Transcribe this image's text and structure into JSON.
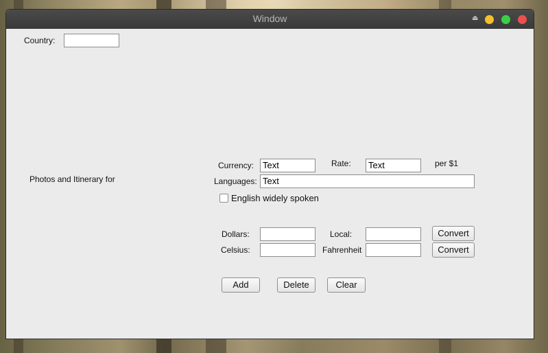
{
  "window": {
    "title": "Window"
  },
  "form": {
    "country_label": "Country:",
    "country_value": "",
    "photos_label": "Photos and Itinerary for",
    "currency_label": "Currency:",
    "currency_value": "Text",
    "rate_label": "Rate:",
    "rate_value": "Text",
    "per_dollar_label": "per $1",
    "languages_label": "Languages:",
    "languages_value": "Text",
    "english_checkbox_label": "English widely spoken",
    "english_checked": false,
    "dollars_label": "Dollars:",
    "dollars_value": "",
    "local_label": "Local:",
    "local_value": "",
    "convert_currency_label": "Convert",
    "celsius_label": "Celsius:",
    "celsius_value": "",
    "fahrenheit_label": "Fahrenheit",
    "fahrenheit_value": "",
    "convert_temp_label": "Convert"
  },
  "actions": {
    "add_label": "Add",
    "delete_label": "Delete",
    "clear_label": "Clear"
  },
  "colors": {
    "close": "#ec4f4f",
    "minimize": "#f5c02a",
    "maximize": "#3ccf45",
    "titlebar": "#3f3f3f",
    "window_bg": "#ebebeb"
  }
}
